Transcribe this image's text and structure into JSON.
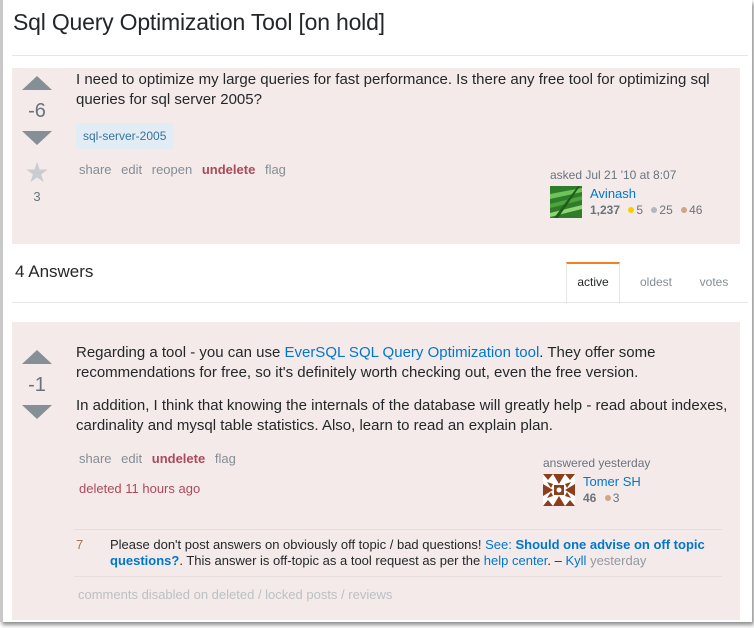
{
  "question": {
    "title": "Sql Query Optimization Tool [on hold]",
    "vote_count": "-6",
    "favorite_count": "3",
    "body": "I need to optimize my large queries for fast performance. Is there any free tool for optimizing sql queries for sql server 2005?",
    "tags": [
      "sql-server-2005"
    ],
    "menu": {
      "share": "share",
      "edit": "edit",
      "reopen": "reopen",
      "undelete": "undelete",
      "flag": "flag"
    },
    "signature": {
      "action": "asked Jul 21 '10 at 8:07",
      "user_name": "Avinash",
      "reputation": "1,237",
      "gold": "5",
      "silver": "25",
      "bronze": "46",
      "avatar_icon": "grass-photo-avatar"
    }
  },
  "answers_section": {
    "header": "4 Answers",
    "tabs": [
      {
        "label": "active",
        "active": true
      },
      {
        "label": "oldest",
        "active": false
      },
      {
        "label": "votes",
        "active": false
      }
    ]
  },
  "answer": {
    "vote_count": "-1",
    "paragraph1_before": "Regarding a tool - you can use ",
    "paragraph1_link": "EverSQL SQL Query Optimization tool",
    "paragraph1_after": ". They offer some recommendations for free, so it's definitely worth checking out, even the free version.",
    "paragraph2": "In addition, I think that knowing the internals of the database will greatly help - read about indexes, cardinality and mysql table statistics. Also, learn to read an explain plan.",
    "menu": {
      "share": "share",
      "edit": "edit",
      "undelete": "undelete",
      "flag": "flag"
    },
    "deleted_note": "deleted 11 hours ago",
    "signature": {
      "action": "answered yesterday",
      "user_name": "Tomer SH",
      "reputation": "46",
      "bronze": "3",
      "avatar_icon": "identicon-avatar"
    },
    "comment": {
      "score": "7",
      "text_before": "Please don't post answers on obviously off topic / bad questions! ",
      "see_label": "See: ",
      "see_link": "Should one advise on off topic questions?",
      "text_middle": ". This answer is off-topic as a tool request as per the ",
      "help_link": "help center",
      "text_end": ". – ",
      "author": "Kyll",
      "time": "yesterday"
    },
    "comments_disabled": "comments disabled on deleted / locked posts / reviews"
  }
}
